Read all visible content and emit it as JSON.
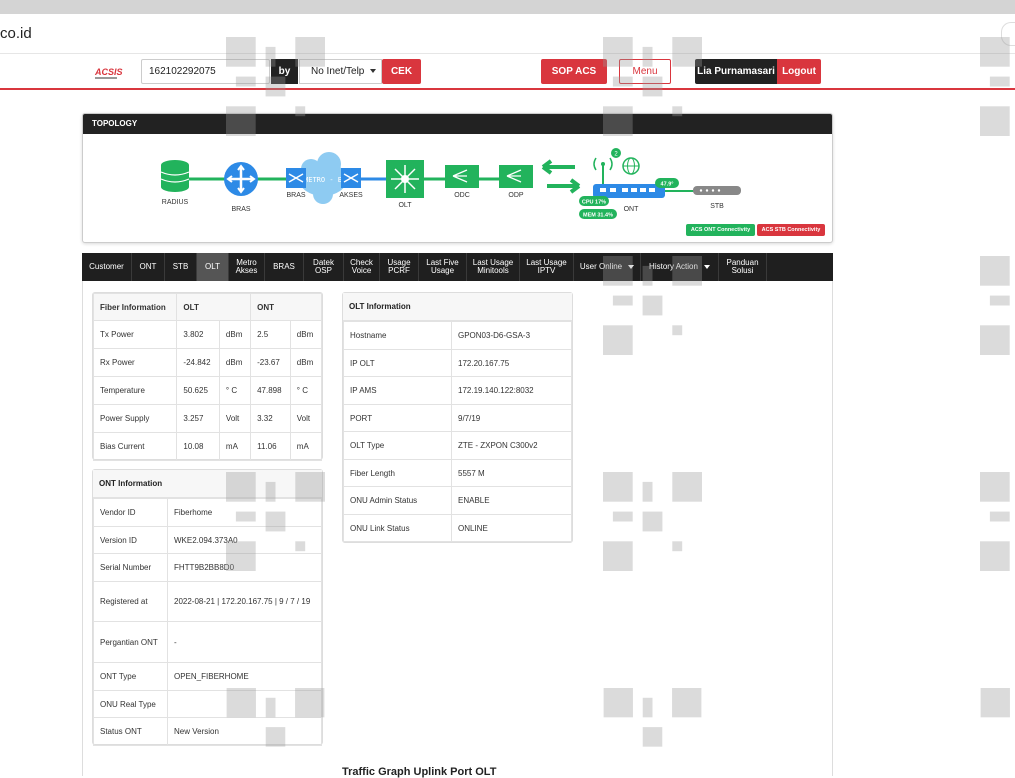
{
  "browser": {
    "url": "co.id"
  },
  "header": {
    "logo": "ACSIS",
    "search": {
      "value": "162102292075"
    },
    "by_label": "by",
    "select_value": "No Inet/Telp",
    "cek_button": "CEK",
    "sop_button": "SOP ACS",
    "menu_button": "Menu",
    "user_name": "Lia Purnamasari",
    "logout_button": "Logout"
  },
  "topology": {
    "title": "TOPOLOGY",
    "nodes": [
      "RADIUS",
      "BRAS",
      "BRAS",
      "METRO - E",
      "AKSES",
      "OLT",
      "ODC",
      "ODP",
      "ONT",
      "STB"
    ],
    "ont_temp": "47.9°",
    "cpu": "CPU 17%",
    "mem": "MEM 31.4%",
    "signal_count": "2",
    "ont_connectivity": "ACS ONT Connectivity",
    "stb_connectivity": "ACS STB Connectivity",
    "colors": {
      "green": "#22b35c",
      "blue": "#2d8ae6",
      "red": "#d9363e",
      "cloud": "#8ecbf2"
    }
  },
  "tabs": [
    {
      "label": "Customer"
    },
    {
      "label": "ONT"
    },
    {
      "label": "STB"
    },
    {
      "label": "OLT",
      "active": true
    },
    {
      "label": "Metro Akses"
    },
    {
      "label": "BRAS"
    },
    {
      "label": "Datek OSP"
    },
    {
      "label": "Check Voice"
    },
    {
      "label": "Usage PCRF"
    },
    {
      "label": "Last Five Usage"
    },
    {
      "label": "Last Usage Minitools"
    },
    {
      "label": "Last Usage IPTV"
    },
    {
      "label": "User Online"
    },
    {
      "label": "History Action"
    },
    {
      "label": "Panduan Solusi"
    }
  ],
  "fiber_info": {
    "headers": [
      "Fiber Information",
      "OLT",
      "ONT"
    ],
    "rows": [
      [
        "Tx Power",
        "3.802",
        "dBm",
        "2.5",
        "dBm"
      ],
      [
        "Rx Power",
        "-24.842",
        "dBm",
        "-23.67",
        "dBm"
      ],
      [
        "Temperature",
        "50.625",
        "° C",
        "47.898",
        "° C"
      ],
      [
        "Power Supply",
        "3.257",
        "Volt",
        "3.32",
        "Volt"
      ],
      [
        "Bias Current",
        "10.08",
        "mA",
        "11.06",
        "mA"
      ]
    ]
  },
  "ont_info": {
    "title": "ONT Information",
    "rows": [
      [
        "Vendor ID",
        "Fiberhome"
      ],
      [
        "Version ID",
        "WKE2.094.373A0"
      ],
      [
        "Serial Number",
        "FHTT9B2BB8D0"
      ],
      [
        "Registered at",
        "2022-08-21 | 172.20.167.75 | 9 / 7 / 19"
      ],
      [
        "Pergantian ONT",
        "-"
      ],
      [
        "ONT Type",
        "OPEN_FIBERHOME"
      ],
      [
        "ONU Real Type",
        ""
      ],
      [
        "Status ONT",
        "New Version"
      ]
    ]
  },
  "olt_info": {
    "title": "OLT Information",
    "rows": [
      [
        "Hostname",
        "GPON03-D6-GSA-3"
      ],
      [
        "IP OLT",
        "172.20.167.75"
      ],
      [
        "IP AMS",
        "172.19.140.122:8032"
      ],
      [
        "PORT",
        "9/7/19"
      ],
      [
        "OLT Type",
        "ZTE - ZXPON C300v2"
      ],
      [
        "Fiber Length",
        "5557 M"
      ],
      [
        "ONU Admin Status",
        "ENABLE"
      ],
      [
        "ONU Link Status",
        "ONLINE"
      ]
    ]
  },
  "graph_title": "Traffic Graph Uplink Port OLT"
}
